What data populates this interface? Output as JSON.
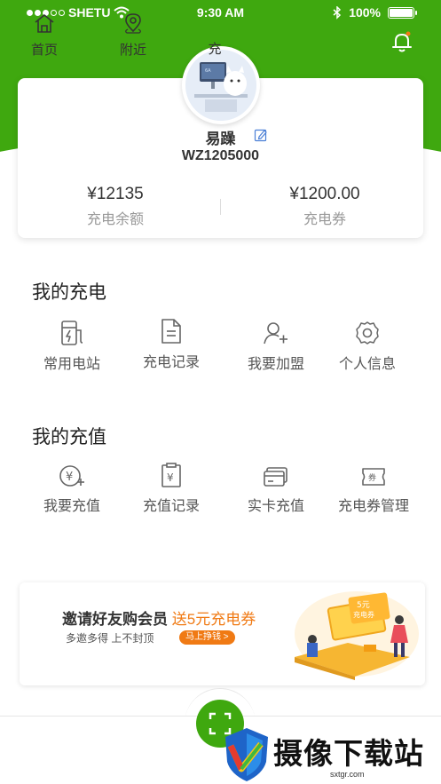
{
  "status_bar": {
    "carrier": "SHETU",
    "time": "9:30 AM",
    "battery": "100%"
  },
  "profile": {
    "name": "易躁",
    "id": "WZ1205000"
  },
  "stats": [
    {
      "value": "¥12135",
      "label": "充电余额"
    },
    {
      "value": "¥1200.00",
      "label": "充电券"
    }
  ],
  "sections": {
    "charge": {
      "title": "我的充电",
      "items": [
        {
          "label": "常用电站",
          "icon": "charging-station-icon"
        },
        {
          "label": "充电记录",
          "icon": "document-icon"
        },
        {
          "label": "我要加盟",
          "icon": "add-user-icon"
        },
        {
          "label": "个人信息",
          "icon": "gear-icon"
        }
      ]
    },
    "topup": {
      "title": "我的充值",
      "items": [
        {
          "label": "我要充值",
          "icon": "yen-plus-icon"
        },
        {
          "label": "充值记录",
          "icon": "clipboard-yen-icon"
        },
        {
          "label": "实卡充值",
          "icon": "card-icon"
        },
        {
          "label": "充电券管理",
          "icon": "coupon-icon"
        }
      ]
    }
  },
  "banner": {
    "title": "邀请好友购会员",
    "highlight": "送5元充电券",
    "subtitle": "多邀多得   上不封顶",
    "button": "马上挣钱 >",
    "coupon_top": "5元",
    "coupon_bottom": "充电券"
  },
  "tabbar": [
    {
      "label": "首页",
      "icon": "home-icon"
    },
    {
      "label": "附近",
      "icon": "location-icon"
    },
    {
      "label": "充",
      "icon": "scan-icon"
    }
  ],
  "watermark": {
    "text": "摄像下载站",
    "url": "sxtgr.com"
  },
  "colors": {
    "brand_green": "#3fa80f",
    "accent_orange": "#f07a14"
  }
}
